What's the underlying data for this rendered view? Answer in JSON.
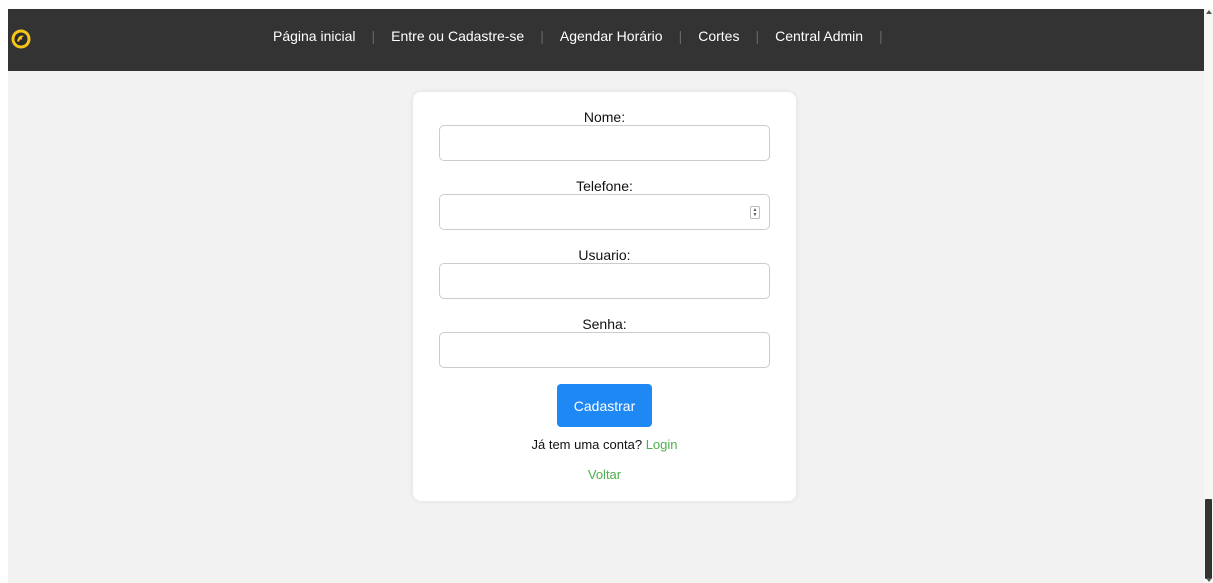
{
  "navbar": {
    "logo_icon": "barber-logo-icon",
    "items": [
      {
        "label": "Página inicial"
      },
      {
        "label": "Entre ou Cadastre-se"
      },
      {
        "label": "Agendar Horário"
      },
      {
        "label": "Cortes"
      },
      {
        "label": "Central Admin"
      }
    ],
    "separator": "|"
  },
  "form": {
    "fields": [
      {
        "label": "Nome:",
        "value": "",
        "type": "text"
      },
      {
        "label": "Telefone:",
        "value": "",
        "type": "number"
      },
      {
        "label": "Usuario:",
        "value": "",
        "type": "text"
      },
      {
        "label": "Senha:",
        "value": "",
        "type": "password"
      }
    ],
    "submit_label": "Cadastrar",
    "login_prompt": "Já tem uma conta?",
    "login_link": "Login",
    "back_link": "Voltar"
  },
  "colors": {
    "navbar_bg": "#333333",
    "page_bg": "#f2f2f2",
    "primary_button": "#1e88f5",
    "link_green": "#4caf50",
    "logo_yellow": "#f5c518"
  }
}
